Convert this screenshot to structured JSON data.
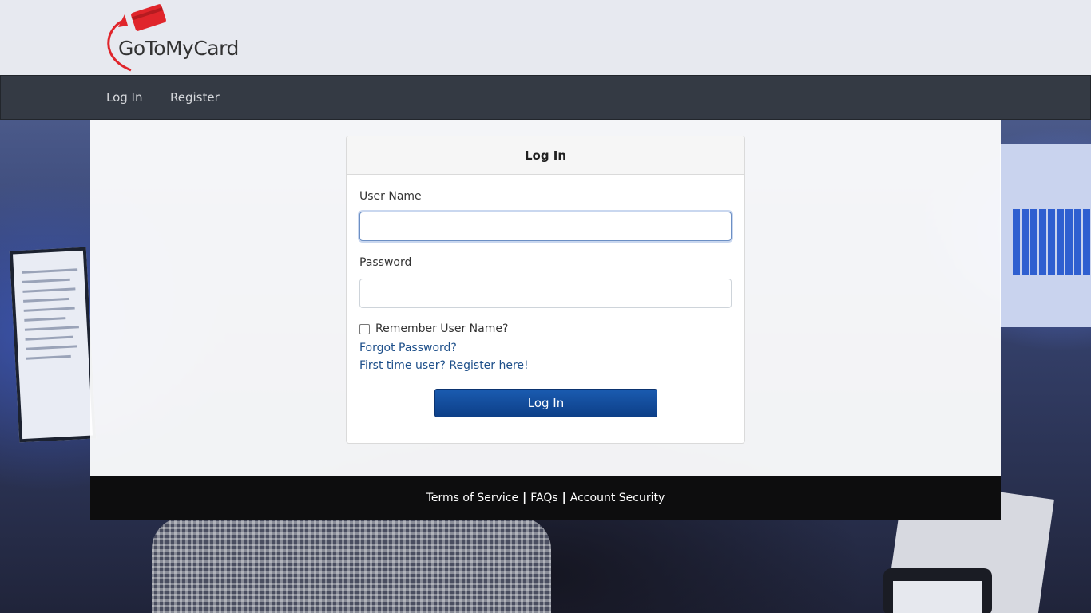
{
  "brand": {
    "logo_text": "GoToMyCard",
    "accent_color": "#e0252b"
  },
  "nav": {
    "items": [
      {
        "label": "Log In"
      },
      {
        "label": "Register"
      }
    ]
  },
  "login_card": {
    "title": "Log In",
    "username_label": "User Name",
    "username_value": "",
    "password_label": "Password",
    "password_value": "",
    "remember_label": "Remember User Name?",
    "remember_checked": false,
    "forgot_link": "Forgot Password?",
    "register_link": "First time user? Register here!",
    "submit_label": "Log In",
    "button_color": "#0d3f88"
  },
  "footer": {
    "links": [
      {
        "label": "Terms of Service"
      },
      {
        "label": "FAQs"
      },
      {
        "label": "Account Security"
      }
    ],
    "separator": "|"
  }
}
